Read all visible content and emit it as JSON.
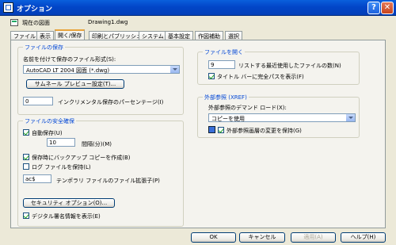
{
  "window": {
    "title": "オプション",
    "help_glyph": "?",
    "close_glyph": "✕"
  },
  "drawing": {
    "label": "現在の図面",
    "value": "Drawing1.dwg"
  },
  "tabs": [
    {
      "label": "ファイル"
    },
    {
      "label": "表示"
    },
    {
      "label": "開く/保存"
    },
    {
      "label": "印刷とパブリッシュ"
    },
    {
      "label": "システム"
    },
    {
      "label": "基本設定"
    },
    {
      "label": "作図補助"
    },
    {
      "label": "選択"
    }
  ],
  "save": {
    "legend": "ファイルの保存",
    "format_label": "名前を付けて保存のファイル形式(S):",
    "format_value": "AutoCAD LT 2004 図面 (*.dwg)",
    "thumbnail_button": "サムネール プレビュー設定(T)...",
    "incremental_value": "0",
    "incremental_label": "インクリメンタル保存のパーセンテージ(I)"
  },
  "safety": {
    "legend": "ファイルの安全確保",
    "autosave_label": "自動保存(U)",
    "interval_value": "10",
    "interval_label": "間隔(分)(M)",
    "backup_label": "保存時にバックアップ コピーを作成(B)",
    "log_label": "ログ ファイルを保持(L)",
    "temp_ext_value": "ac$",
    "temp_ext_label": "テンポラリ ファイルのファイル拡張子(P)",
    "security_button": "セキュリティ オプション(O)...",
    "signature_label": "デジタル署名情報を表示(E)"
  },
  "file_open": {
    "legend": "ファイルを開く",
    "recent_value": "9",
    "recent_label": "リストする最近使用したファイルの数(N)",
    "fullpath_label": "タイトル バーに完全パスを表示(F)"
  },
  "xref": {
    "legend": "外部参照 (XREF)",
    "demand_label": "外部参照のデマンド ロード(X):",
    "demand_value": "コピーを使用",
    "retain_label": "外部参照画層の変更を保持(G)"
  },
  "footer": {
    "ok": "OK",
    "cancel": "キャンセル",
    "apply": "適用(A)",
    "help": "ヘルプ(H)"
  },
  "checkbox_states": {
    "autosave": true,
    "backup": true,
    "log": false,
    "signature": true,
    "fullpath": true,
    "retain": true
  }
}
